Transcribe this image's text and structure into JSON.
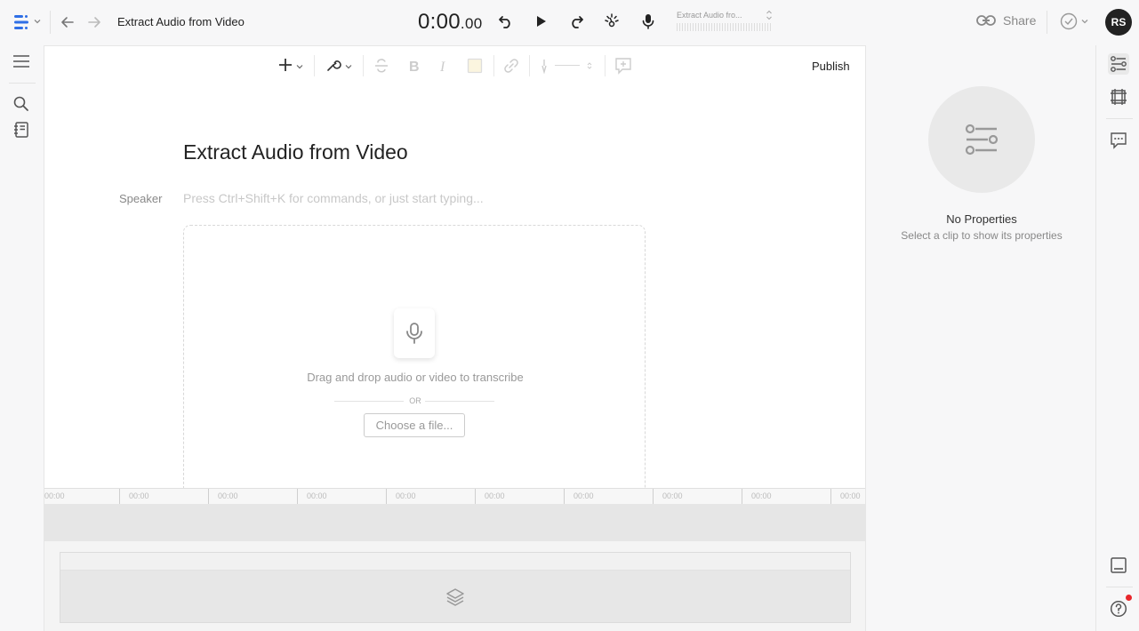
{
  "topbar": {
    "document_title": "Extract Audio from Video",
    "timecode_main": "0:00",
    "timecode_frac": ".00",
    "mini_track_title": "Extract Audio fro...",
    "share_label": "Share",
    "avatar_initials": "RS"
  },
  "toolbar": {
    "publish_label": "Publish"
  },
  "editor": {
    "title": "Extract Audio from Video",
    "speaker_label": "Speaker",
    "placeholder": "Press Ctrl+Shift+K for commands, or just start typing..."
  },
  "dropzone": {
    "instruction": "Drag and drop audio or video to transcribe",
    "or_label": "OR",
    "choose_file_label": "Choose a file..."
  },
  "timeline": {
    "ticks": [
      "00:00",
      "00:00",
      "00:00",
      "00:00",
      "00:00",
      "00:00",
      "00:00",
      "00:00",
      "00:00",
      "00:00"
    ]
  },
  "properties": {
    "title": "No Properties",
    "subtitle": "Select a clip to show its properties"
  },
  "colors": {
    "accent": "#2f6fe6",
    "notification": "#e8262b",
    "avatar_bg": "#222222"
  }
}
